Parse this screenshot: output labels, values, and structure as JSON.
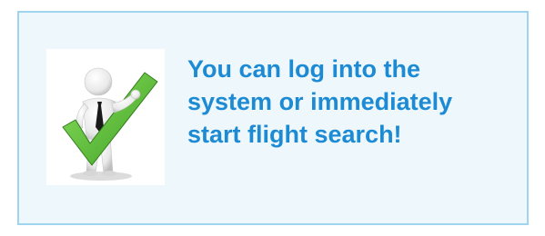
{
  "info_panel": {
    "message": "You can log into the\nsystem or immediately\nstart flight search!",
    "illustration_icon": "person-with-green-checkmark-icon"
  },
  "colors": {
    "panel_background": "#eef7fc",
    "panel_border": "#9fd4ef",
    "message_text": "#1d8bd3",
    "checkmark": "#5cc23a",
    "tie": "#1a1a1a"
  }
}
